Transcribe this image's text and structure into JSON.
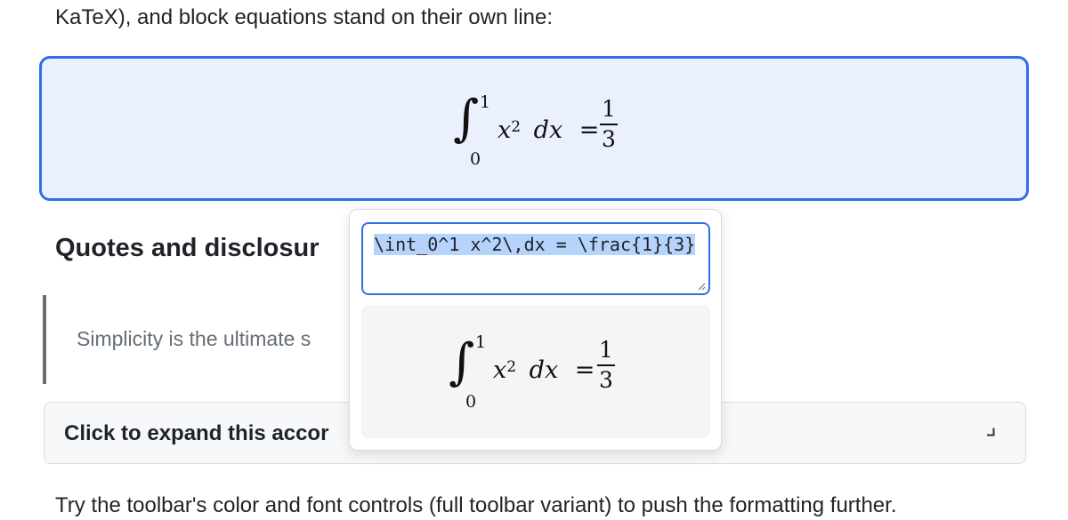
{
  "intro": {
    "text": "KaTeX), and block equations stand on their own line:"
  },
  "math_block": {
    "integral_lower": "0",
    "integral_upper": "1",
    "integrand_var": "x",
    "integrand_exp": "2",
    "differential": "dx",
    "equals": "=",
    "frac_num": "1",
    "frac_den": "3"
  },
  "section": {
    "heading": "Quotes and disclosur"
  },
  "quote": {
    "text": "Simplicity is the ultimate s"
  },
  "accordion": {
    "label": "Click to expand this accor",
    "icon": "corner-down-left-icon"
  },
  "footer": {
    "text": "Try the toolbar's color and font controls (full toolbar variant) to push the formatting further."
  },
  "popover": {
    "latex_value": "\\int_0^1 x^2\\,dx = \\frac{1}{3}",
    "preview": {
      "integral_lower": "0",
      "integral_upper": "1",
      "integrand_var": "x",
      "integrand_exp": "2",
      "differential": "dx",
      "equals": "=",
      "frac_num": "1",
      "frac_den": "3"
    }
  },
  "colors": {
    "accent": "#2f6ee8",
    "math_block_bg": "#eaf0fe",
    "selection": "#b5d3fb",
    "muted_text": "#656d76"
  }
}
